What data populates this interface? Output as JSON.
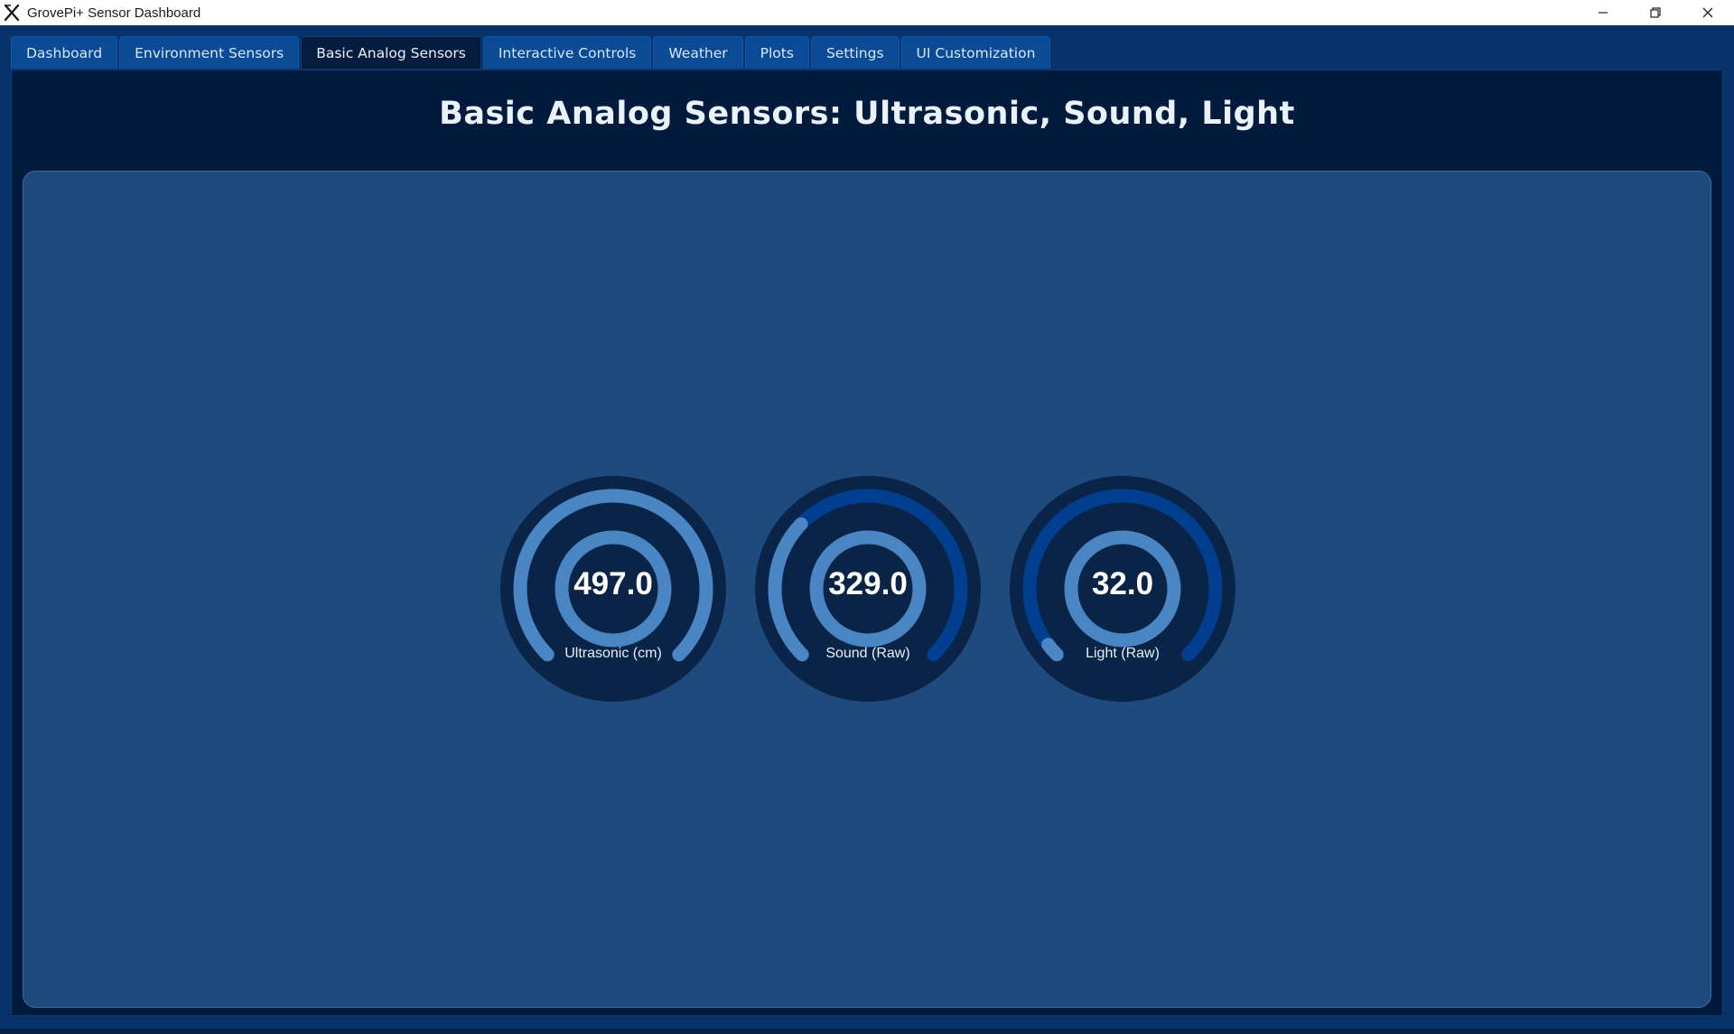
{
  "window": {
    "title": "GrovePi+ Sensor Dashboard",
    "app_icon": "x-logo-icon",
    "controls": [
      "minimize-icon",
      "restore-icon",
      "close-icon"
    ]
  },
  "tabs": [
    {
      "label": "Dashboard",
      "active": false
    },
    {
      "label": "Environment Sensors",
      "active": false
    },
    {
      "label": "Basic Analog Sensors",
      "active": true
    },
    {
      "label": "Interactive Controls",
      "active": false
    },
    {
      "label": "Weather",
      "active": false
    },
    {
      "label": "Plots",
      "active": false
    },
    {
      "label": "Settings",
      "active": false
    },
    {
      "label": "UI Customization",
      "active": false
    }
  ],
  "page": {
    "title": "Basic Analog Sensors: Ultrasonic, Sound, Light"
  },
  "gauges": [
    {
      "value_text": "497.0",
      "label": "Ultrasonic (cm)",
      "fill_fraction": 1.0
    },
    {
      "value_text": "329.0",
      "label": "Sound (Raw)",
      "fill_fraction": 0.33
    },
    {
      "value_text": "32.0",
      "label": "Light (Raw)",
      "fill_fraction": 0.03
    }
  ],
  "colors": {
    "background": "#07326a",
    "panel": "#021a3c",
    "card": "#1f4a7e",
    "gauge_face": "#0a2448",
    "gauge_track": "#003f8f",
    "gauge_fill": "#4a86c3",
    "title_text": "#eaf2fb"
  }
}
